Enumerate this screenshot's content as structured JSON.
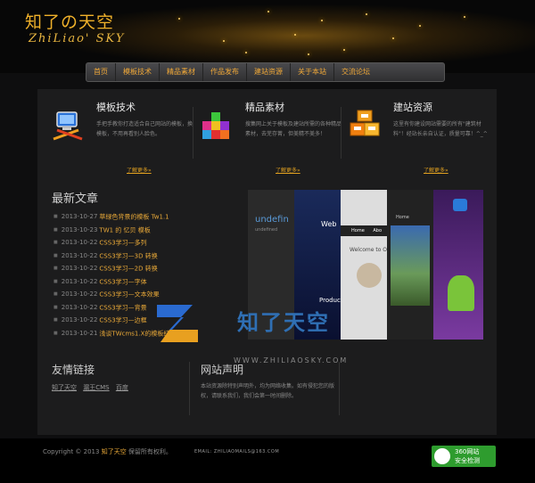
{
  "logo": {
    "cn": "知了の天空",
    "en": "ZhiLiao' SKY"
  },
  "nav": [
    "首页",
    "模板技术",
    "精品素材",
    "作品发布",
    "建站资源",
    "关于本站",
    "交流论坛"
  ],
  "features": [
    {
      "title": "模板技术",
      "desc": "手把手教你打造适合自己网站的模板，换模板，不用再看别人脸色。",
      "more": "了解更多»",
      "icon": "computer-tools-icon"
    },
    {
      "title": "精品素材",
      "desc": "搜集网上关于模板及建站所需的各种精品素材，去芜存菁，但美精不美多！",
      "more": "了解更多»",
      "icon": "colored-cubes-icon"
    },
    {
      "title": "建站资源",
      "desc": "这里有你建设网站需要的所有\"建筑材料\"！经站长亲自认证，质量可靠！^_^",
      "more": "了解更多»",
      "icon": "orange-blocks-icon"
    }
  ],
  "articles": {
    "title": "最新文章",
    "items": [
      {
        "date": "2013-10-27",
        "title": "草绿色背景的模板 Tw1.1"
      },
      {
        "date": "2013-10-23",
        "title": "TW1 的 忆贝 模板"
      },
      {
        "date": "2013-10-22",
        "title": "CSS3学习—多列"
      },
      {
        "date": "2013-10-22",
        "title": "CSS3学习—3D 转换"
      },
      {
        "date": "2013-10-22",
        "title": "CSS3学习—2D 转换"
      },
      {
        "date": "2013-10-22",
        "title": "CSS3学习—字体"
      },
      {
        "date": "2013-10-22",
        "title": "CSS3学习—文本效果"
      },
      {
        "date": "2013-10-22",
        "title": "CSS3学习—背景"
      },
      {
        "date": "2013-10-22",
        "title": "CSS3学习—边框"
      },
      {
        "date": "2013-10-21",
        "title": "浅谈TWcms1.X的模板结构"
      }
    ]
  },
  "slider": {
    "panel_text_1": "undefin",
    "panel_text_1b": "undefined",
    "panel_text_2": "Web",
    "panel_text_2b": "Product",
    "panel_text_3": "Welcome to Our",
    "panel_nav": [
      "Home",
      "Abo"
    ],
    "panel_text_4": "Home"
  },
  "overlay": {
    "cn": "知了天空",
    "en": "WWW.ZHILIAOSKY.COM"
  },
  "links": {
    "title": "友情链接",
    "items": [
      "知了天空",
      "漏王CMS",
      "百度"
    ]
  },
  "statement": {
    "title": "网站声明",
    "text": "本站资源除特别声明外，均为网络收集。如有侵犯您的版权，请联系我们，我们会第一时间删除。"
  },
  "footer": {
    "copy_prefix": "Copyright © 2013 ",
    "copy_site": "知了天空",
    "copy_suffix": " 保留所有权利。",
    "email": "EMAIL: ZHILIAOMAILS@163.COM",
    "badge_line1": "360网站",
    "badge_line2": "安全检测"
  },
  "colors": {
    "accent": "#e8a838",
    "page_bg": "#0e0e0f",
    "content_bg": "#1c1c1d",
    "badge": "#2e9c2e"
  }
}
